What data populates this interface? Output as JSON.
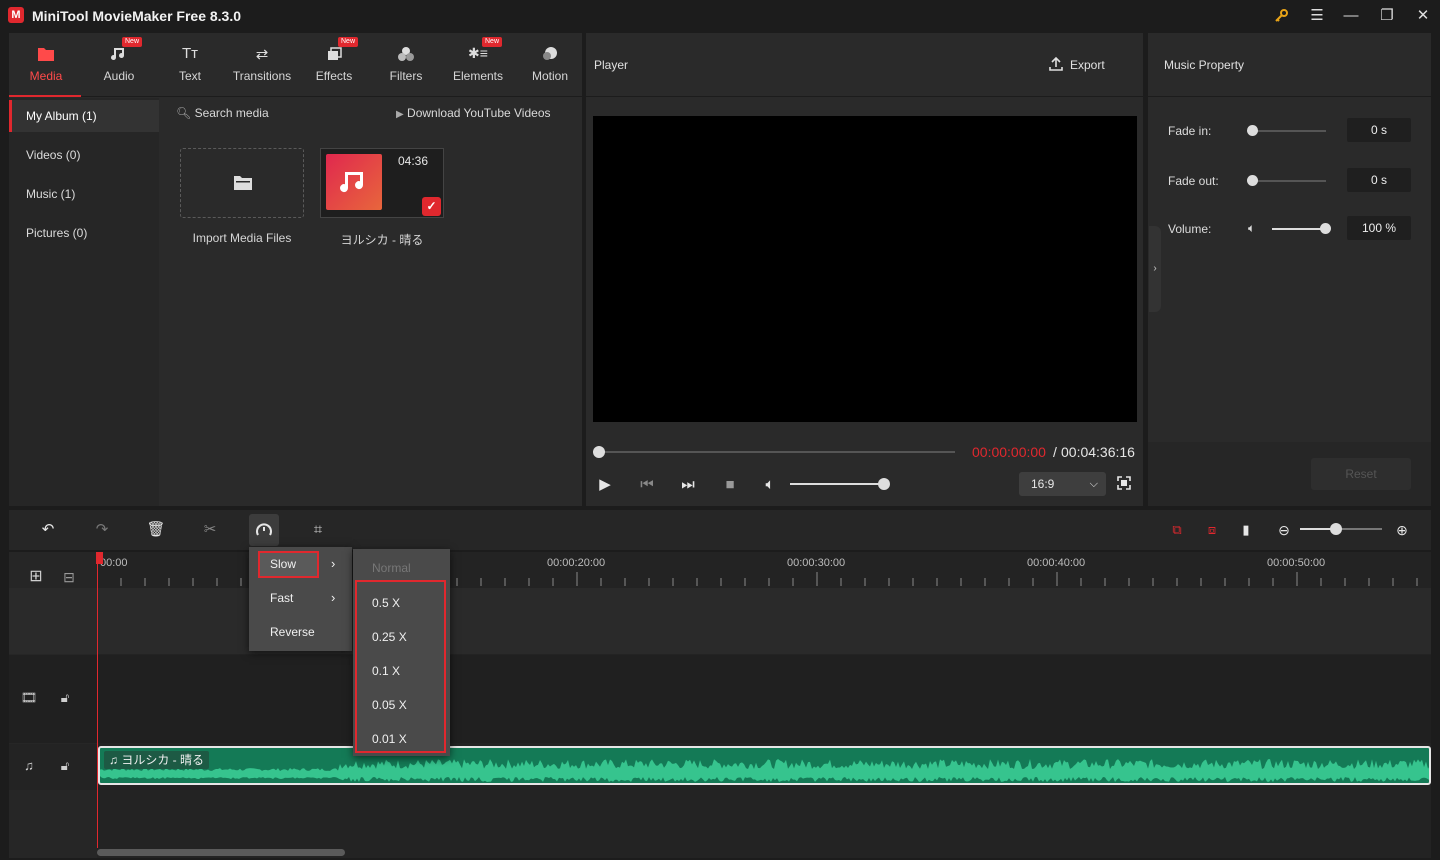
{
  "app": {
    "title": "MiniTool MovieMaker Free 8.3.0",
    "logo_letter": "M"
  },
  "window": {
    "key_icon": "key-icon",
    "menu_icon": "hamburger-icon",
    "min_icon": "minimize-icon",
    "max_icon": "maximize-icon",
    "close_icon": "close-icon"
  },
  "toolbar": {
    "items": [
      {
        "label": "Media",
        "icon": "media-icon",
        "active": true,
        "new": false
      },
      {
        "label": "Audio",
        "icon": "music-note-icon",
        "active": false,
        "new": true
      },
      {
        "label": "Text",
        "icon": "text-icon",
        "active": false,
        "new": false
      },
      {
        "label": "Transitions",
        "icon": "transitions-icon",
        "active": false,
        "new": false
      },
      {
        "label": "Effects",
        "icon": "effects-icon",
        "active": false,
        "new": true
      },
      {
        "label": "Filters",
        "icon": "filters-icon",
        "active": false,
        "new": false
      },
      {
        "label": "Elements",
        "icon": "elements-icon",
        "active": false,
        "new": true
      },
      {
        "label": "Motion",
        "icon": "motion-icon",
        "active": false,
        "new": false
      }
    ],
    "new_badge": "New"
  },
  "sidebar": {
    "items": [
      {
        "label": "My Album (1)",
        "active": true
      },
      {
        "label": "Videos (0)"
      },
      {
        "label": "Music (1)"
      },
      {
        "label": "Pictures (0)"
      }
    ]
  },
  "media": {
    "search_placeholder": "Search media",
    "download_label": "Download YouTube Videos",
    "import_label": "Import Media Files",
    "item": {
      "duration": "04:36",
      "name": "ヨルシカ - 晴る",
      "selected": true
    }
  },
  "player": {
    "title": "Player",
    "export_label": "Export",
    "time_current": "00:00:00:00",
    "time_separator": "/",
    "time_total": "00:04:36:16",
    "aspect_ratio": "16:9",
    "seek_fraction": 0.0,
    "volume_fraction": 1.0
  },
  "property": {
    "title": "Music Property",
    "fade_in": {
      "label": "Fade in:",
      "value": "0 s"
    },
    "fade_out": {
      "label": "Fade out:",
      "value": "0 s"
    },
    "volume": {
      "label": "Volume:",
      "value": "100 %"
    },
    "reset_label": "Reset"
  },
  "timeline": {
    "ruler_labels": [
      "00:00",
      "00:00:20:00",
      "00:00:30:00",
      "00:00:40:00",
      "00:00:50:00"
    ],
    "clip_label": "ヨルシカ - 晴る",
    "accent": "#e0282e",
    "clip_color": "#147a56"
  },
  "speed_menu": {
    "items": [
      {
        "label": "Slow",
        "has_sub": true,
        "highlighted": true
      },
      {
        "label": "Fast",
        "has_sub": true
      },
      {
        "label": "Reverse",
        "has_sub": false
      }
    ],
    "submenu_disabled": "Normal",
    "submenu": [
      "0.5 X",
      "0.25 X",
      "0.1 X",
      "0.05 X",
      "0.01 X"
    ]
  }
}
